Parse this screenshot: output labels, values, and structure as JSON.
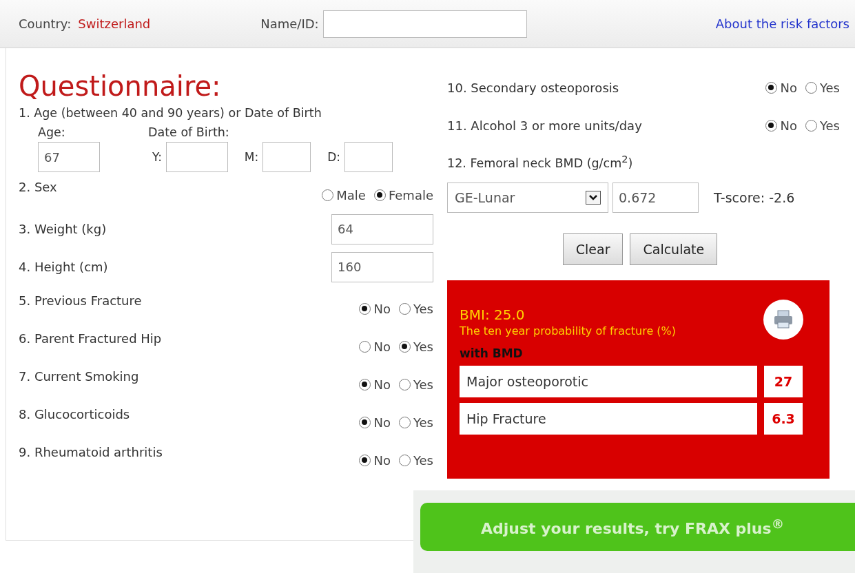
{
  "header": {
    "country_label": "Country:",
    "country": "Switzerland",
    "name_label": "Name/ID:",
    "link": "About the risk factors"
  },
  "title": "Questionnaire:",
  "age_question": {
    "label": "1. Age (between 40 and 90 years) or Date of Birth",
    "age_label": "Age:",
    "age_value": "67",
    "dob_label": "Date of Birth:",
    "dob_fields": [
      {
        "label": "Y:"
      },
      {
        "label": "M:"
      },
      {
        "label": "D:"
      }
    ]
  },
  "left_questions": [
    {
      "kind": "radio",
      "label": "2. Sex",
      "options": [
        {
          "label": "Male",
          "selected": false
        },
        {
          "label": "Female",
          "selected": true
        }
      ]
    },
    {
      "kind": "input",
      "label": "3. Weight (kg)",
      "value": "64"
    },
    {
      "kind": "input",
      "label": "4. Height (cm)",
      "value": "160"
    },
    {
      "kind": "radio",
      "label": "5. Previous Fracture",
      "options": [
        {
          "label": "No",
          "selected": true
        },
        {
          "label": "Yes",
          "selected": false
        }
      ]
    },
    {
      "kind": "radio",
      "label": "6. Parent Fractured Hip",
      "options": [
        {
          "label": "No",
          "selected": false
        },
        {
          "label": "Yes",
          "selected": true
        }
      ]
    },
    {
      "kind": "radio",
      "label": "7. Current Smoking",
      "options": [
        {
          "label": "No",
          "selected": true
        },
        {
          "label": "Yes",
          "selected": false
        }
      ]
    },
    {
      "kind": "radio",
      "label": "8. Glucocorticoids",
      "options": [
        {
          "label": "No",
          "selected": true
        },
        {
          "label": "Yes",
          "selected": false
        }
      ]
    },
    {
      "kind": "radio",
      "label": "9. Rheumatoid arthritis",
      "options": [
        {
          "label": "No",
          "selected": true
        },
        {
          "label": "Yes",
          "selected": false
        }
      ]
    }
  ],
  "right_questions": [
    {
      "kind": "radio",
      "label": "10. Secondary osteoporosis",
      "options": [
        {
          "label": "No",
          "selected": true
        },
        {
          "label": "Yes",
          "selected": false
        }
      ]
    },
    {
      "kind": "radio",
      "label": "11. Alcohol 3 or more units/day",
      "options": [
        {
          "label": "No",
          "selected": true
        },
        {
          "label": "Yes",
          "selected": false
        }
      ]
    }
  ],
  "bmd": {
    "label": "12. Femoral neck BMD (g/cm$^{2}$)",
    "device": "GE-Lunar",
    "value": "0.672",
    "t_score": "T-score: -2.6"
  },
  "buttons": [
    "Clear",
    "Calculate"
  ],
  "results": {
    "bmi": "BMI: 25.0",
    "caption": "The ten year probability of fracture (%)",
    "section": "with BMD",
    "rows": [
      {
        "label": "Major osteoporotic",
        "value": "27"
      },
      {
        "label": "Hip Fracture",
        "value": "6.3"
      }
    ]
  },
  "banner": "Adjust your results, try FRAX plus$^{®}$"
}
